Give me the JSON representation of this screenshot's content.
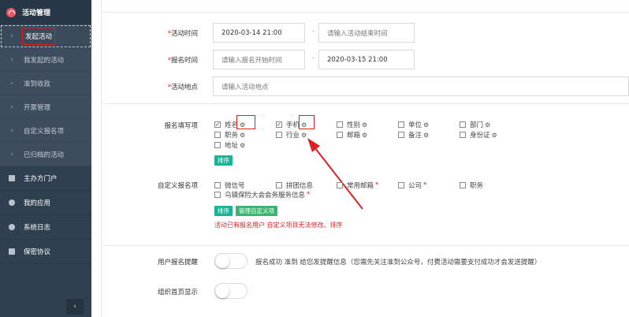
{
  "sidebar": {
    "header": "活动管理",
    "sub_items": [
      {
        "label": "发起活动"
      },
      {
        "label": "我发起的活动"
      },
      {
        "label": "准到收款"
      },
      {
        "label": "开票管理"
      },
      {
        "label": "自定义报名项"
      },
      {
        "label": "已归档的活动"
      }
    ],
    "menu_items": [
      {
        "label": "主办方门户"
      },
      {
        "label": "我的应用"
      },
      {
        "label": "系统日志"
      },
      {
        "label": "保密协议"
      }
    ],
    "collapse": "‹"
  },
  "form": {
    "activity_time": {
      "label": "活动时间",
      "required": "*",
      "start": "2020-03-14 21:00",
      "end_placeholder": "请输入活动结束时间"
    },
    "signup_time": {
      "label": "报名时间",
      "required": "*",
      "start_placeholder": "请输入报名开始时间",
      "end": "2020-03-15 21:00"
    },
    "location": {
      "label": "活动地点",
      "required": "*",
      "placeholder": "请输入活动地点"
    },
    "signup_fields": {
      "label": "报名填写项",
      "items": [
        {
          "label": "姓名",
          "checked": "✓"
        },
        {
          "label": "手机",
          "checked": "✓"
        },
        {
          "label": "性别"
        },
        {
          "label": "单位"
        },
        {
          "label": "部门"
        },
        {
          "label": "职务"
        },
        {
          "label": "行业"
        },
        {
          "label": "邮箱"
        },
        {
          "label": "备注"
        },
        {
          "label": "身份证"
        },
        {
          "label": "地址"
        }
      ],
      "sort_button": "排序"
    },
    "custom_fields": {
      "label": "自定义报名项",
      "items": [
        {
          "label": "微信号"
        },
        {
          "label": "拼团信息"
        },
        {
          "label": "常用邮箱",
          "star": "*"
        },
        {
          "label": "公司",
          "star": "*"
        },
        {
          "label": "职务"
        },
        {
          "label": "乌镇保险大会会务服务信息",
          "star": "*"
        }
      ],
      "sort_button": "排序",
      "manage_button": "管理自定义项",
      "warning": "活动已有报名用户 自定义项目无法修改、排序"
    },
    "reminder": {
      "label": "用户报名提醒",
      "note": "报名成功 准到 给您发提醒信息（您需先关注准到公众号，付费活动需要支付成功才会发送提醒）"
    },
    "homepage": {
      "label": "组织首页显示"
    }
  },
  "colors": {
    "sidebar": "#2f4050",
    "accent": "#1ab394",
    "highlight": "#e02020"
  },
  "icons": {
    "gear": "⚙",
    "chevron": "›"
  }
}
